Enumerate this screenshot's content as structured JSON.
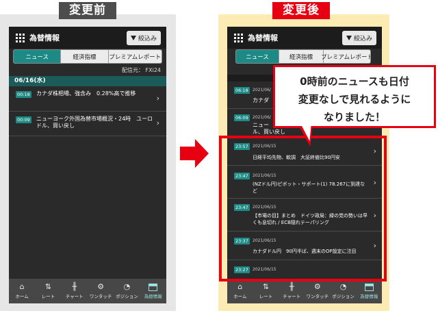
{
  "labels": {
    "before": "変更前",
    "after": "変更後"
  },
  "header": {
    "title": "為替情報",
    "filter_label": "絞込み"
  },
  "tabs": [
    "ニュース",
    "経済指標",
    "プレミアムレポート"
  ],
  "provider": "配信元： FXi24",
  "before": {
    "date": "06/16(水)",
    "items": [
      {
        "time": "00:18",
        "title": "カナダ株相場、強含み　0.28%高で推移"
      },
      {
        "time": "00:09",
        "title": "ニューヨーク外国為替市場概況・24時　ユーロドル、買い戻し"
      }
    ]
  },
  "after": {
    "top_items": [
      {
        "time": "06:18",
        "date": "2021/06/",
        "title": "カナダ"
      },
      {
        "time": "06:09",
        "date": "2021/06/",
        "title": "ニュー",
        "title2": "ル、買い戻し"
      }
    ],
    "items": [
      {
        "time": "23:57",
        "date": "2021/06/15",
        "title": "日経平均先物、軟調　大証終値比90円安"
      },
      {
        "time": "23:47",
        "date": "2021/06/15",
        "title": "(NZドル円)ピボット・サポート(1) 78.267に到達など"
      },
      {
        "time": "23:47",
        "date": "2021/06/15",
        "title": "【市場の目】まとめ　ドイツ政局：緑の党の勢いは早くも息切れ / ECB隠れテーパリング"
      },
      {
        "time": "23:37",
        "date": "2021/06/15",
        "title": "カナダドル円　90円半ば、週末のOP設定に注目"
      },
      {
        "time": "23:27",
        "date": "2021/06/15",
        "title": ""
      }
    ]
  },
  "callout": {
    "line1": "0時前のニュースも日付",
    "line2": "変更なしで見れるように",
    "line3": "なりました！"
  },
  "nav": [
    {
      "icon": "home-icon",
      "glyph": "⌂",
      "label": "ホーム"
    },
    {
      "icon": "rate-icon",
      "glyph": "⇅",
      "label": "レート"
    },
    {
      "icon": "chart-icon",
      "glyph": "╫",
      "label": "チャート"
    },
    {
      "icon": "one-touch-icon",
      "glyph": "⚙",
      "label": "ワンタッチ"
    },
    {
      "icon": "position-icon",
      "glyph": "◔",
      "label": "ポジション"
    },
    {
      "icon": "news-icon",
      "glyph": "",
      "label": "為替情報"
    }
  ],
  "colors": {
    "accent": "#1d8a86",
    "highlight": "#e60012",
    "after_bg": "#fcebb3",
    "before_bg": "#e6e6e6"
  }
}
